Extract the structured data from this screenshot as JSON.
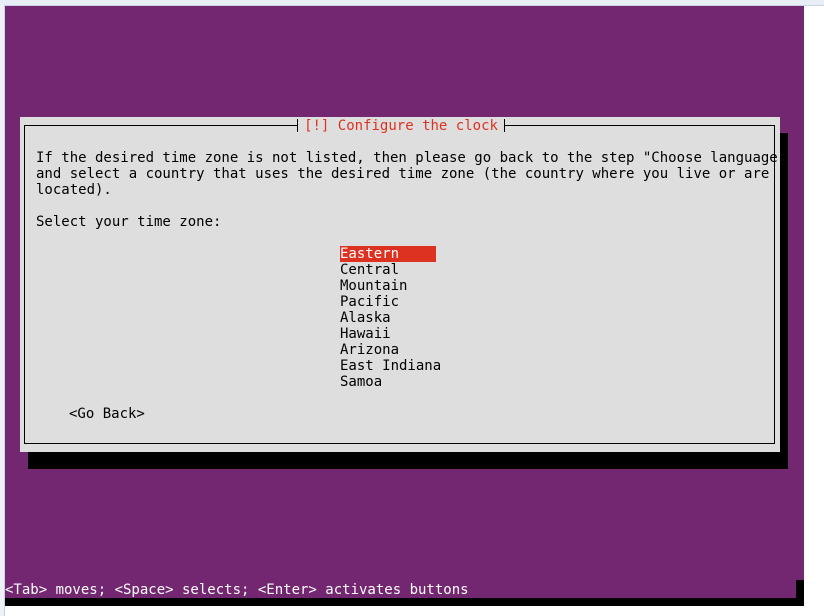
{
  "dialog": {
    "title": "[!] Configure the clock",
    "description": "If the desired time zone is not listed, then please go back to the step \"Choose language\"\nand select a country that uses the desired time zone (the country where you live or are\nlocated).",
    "select_label": "Select your time zone:",
    "timezones": [
      "Eastern",
      "Central",
      "Mountain",
      "Pacific",
      "Alaska",
      "Hawaii",
      "Arizona",
      "East Indiana",
      "Samoa"
    ],
    "selected_timezone": "Eastern",
    "go_back_label": "<Go Back>"
  },
  "status_bar": {
    "text": "<Tab> moves; <Space> selects; <Enter> activates buttons"
  },
  "colors": {
    "background": "#722770",
    "dialog": "#dedede",
    "accent": "#dd3222",
    "shadow": "#000000"
  }
}
